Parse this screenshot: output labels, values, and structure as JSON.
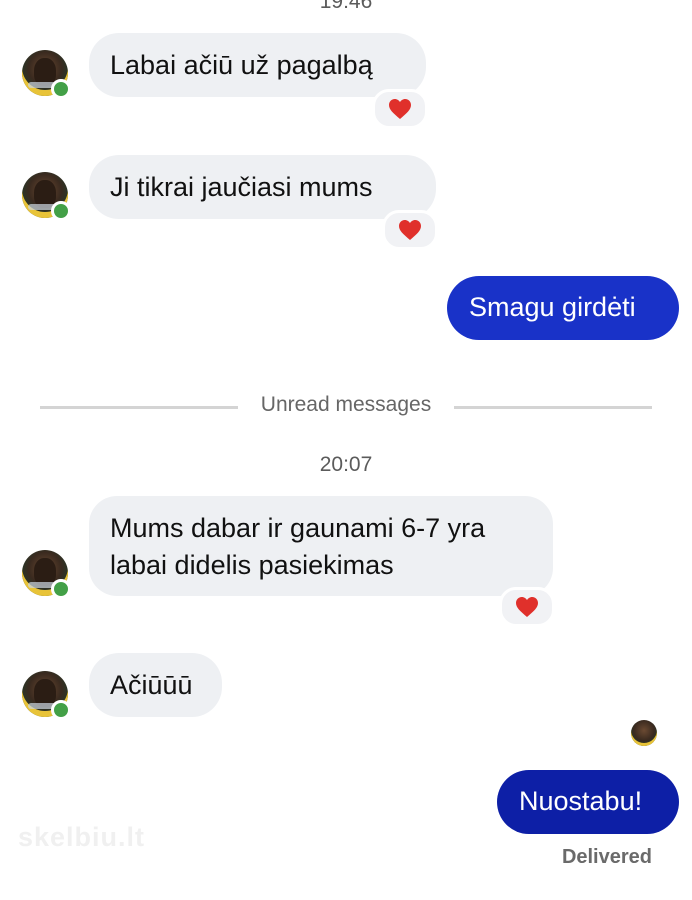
{
  "conversation": {
    "messages": [
      {
        "id": "m0-time",
        "time": "19:46"
      },
      {
        "text": "Labai ačiū už pagalbą",
        "reaction": "heart"
      },
      {
        "text": "Ji tikrai jaučiasi mums",
        "reaction": "heart"
      },
      {
        "text": "Smagu girdėti"
      },
      {
        "text": "Mums dabar ir gaunami 6-7 yra labai didelis pasiekimas",
        "line1": "Mums dabar ir gaunami 6-7 yra",
        "line2": "labai didelis pasiekimas",
        "reaction": "heart"
      },
      {
        "text": "Ačiūūū"
      },
      {
        "text": "Nuostabu!"
      }
    ],
    "unread_divider": "Unread messages",
    "time_second": "20:07",
    "status": "Delivered"
  },
  "watermark": "skelbiu.lt",
  "colors": {
    "outgoing_bubble": "#1932c8",
    "outgoing_bubble_last": "#0d1fa6",
    "incoming_bubble": "#eef0f3",
    "heart": "#e0302b",
    "online_dot": "#43a047"
  },
  "icons": {
    "reaction": "heart-icon",
    "status": "online-dot-icon"
  }
}
